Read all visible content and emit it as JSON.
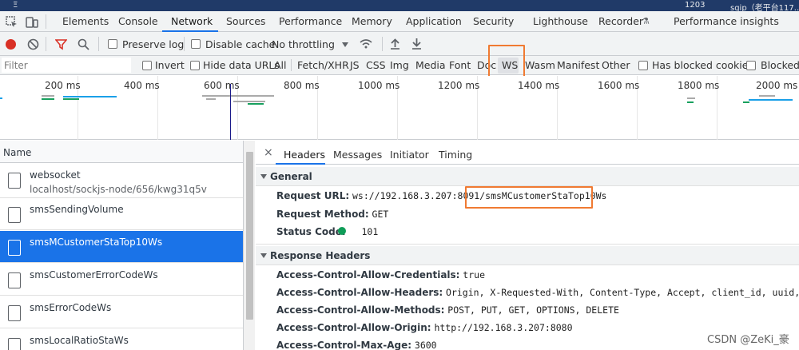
{
  "title_strip": {
    "left_a": "Ξ",
    "right_a": "1203",
    "right_b": "sgip（老平台117..."
  },
  "devtools_tabs": [
    "Elements",
    "Console",
    "Network",
    "Sources",
    "Performance",
    "Memory",
    "Application",
    "Security",
    "Lighthouse",
    "Recorder",
    "Performance insights"
  ],
  "toolbar": {
    "preserve_log": "Preserve log",
    "disable_cache": "Disable cache",
    "throttling": "No throttling"
  },
  "filterbar": {
    "placeholder": "Filter",
    "invert": "Invert",
    "hide_data_urls": "Hide data URLs",
    "types": [
      "All",
      "Fetch/XHR",
      "JS",
      "CSS",
      "Img",
      "Media",
      "Font",
      "Doc",
      "WS",
      "Wasm",
      "Manifest",
      "Other"
    ],
    "has_blocked_cookies": "Has blocked cookies",
    "blocked": "Blocked R"
  },
  "overview": {
    "ticks": [
      "200 ms",
      "400 ms",
      "600 ms",
      "800 ms",
      "1000 ms",
      "1200 ms",
      "1400 ms",
      "1600 ms",
      "1800 ms",
      "2000 ms"
    ]
  },
  "list": {
    "header": "Name",
    "items": [
      {
        "name": "websocket",
        "sub": "localhost/sockjs-node/656/kwg31q5v"
      },
      {
        "name": "smsSendingVolume"
      },
      {
        "name": "smsMCustomerStaTop10Ws"
      },
      {
        "name": "smsCustomerErrorCodeWs"
      },
      {
        "name": "smsErrorCodeWs"
      },
      {
        "name": "smsLocalRatioStaWs"
      }
    ]
  },
  "detail_tabs": [
    "Headers",
    "Messages",
    "Initiator",
    "Timing"
  ],
  "general": {
    "title": "General",
    "request_url_label": "Request URL:",
    "request_url_prefix": "ws://192.168.3.207:8091/",
    "request_url_path": "smsMCustomerStaTop10Ws",
    "method_label": "Request Method:",
    "method": "GET",
    "status_label": "Status Code:",
    "status": "101"
  },
  "response_headers": {
    "title": "Response Headers",
    "items": [
      {
        "k": "Access-Control-Allow-Credentials:",
        "v": "true"
      },
      {
        "k": "Access-Control-Allow-Headers:",
        "v": "Origin, X-Requested-With, Content-Type, Accept, client_id, uuid, Authori"
      },
      {
        "k": "Access-Control-Allow-Methods:",
        "v": "POST, PUT, GET, OPTIONS, DELETE"
      },
      {
        "k": "Access-Control-Allow-Origin:",
        "v": "http://192.168.3.207:8080"
      },
      {
        "k": "Access-Control-Max-Age:",
        "v": "3600"
      }
    ]
  },
  "watermark": "CSDN @ZeKi_豪",
  "colors": {
    "accent": "#1a73e8",
    "highlight": "#f07a32",
    "record": "#d93025",
    "status_ok": "#0f9d58"
  }
}
